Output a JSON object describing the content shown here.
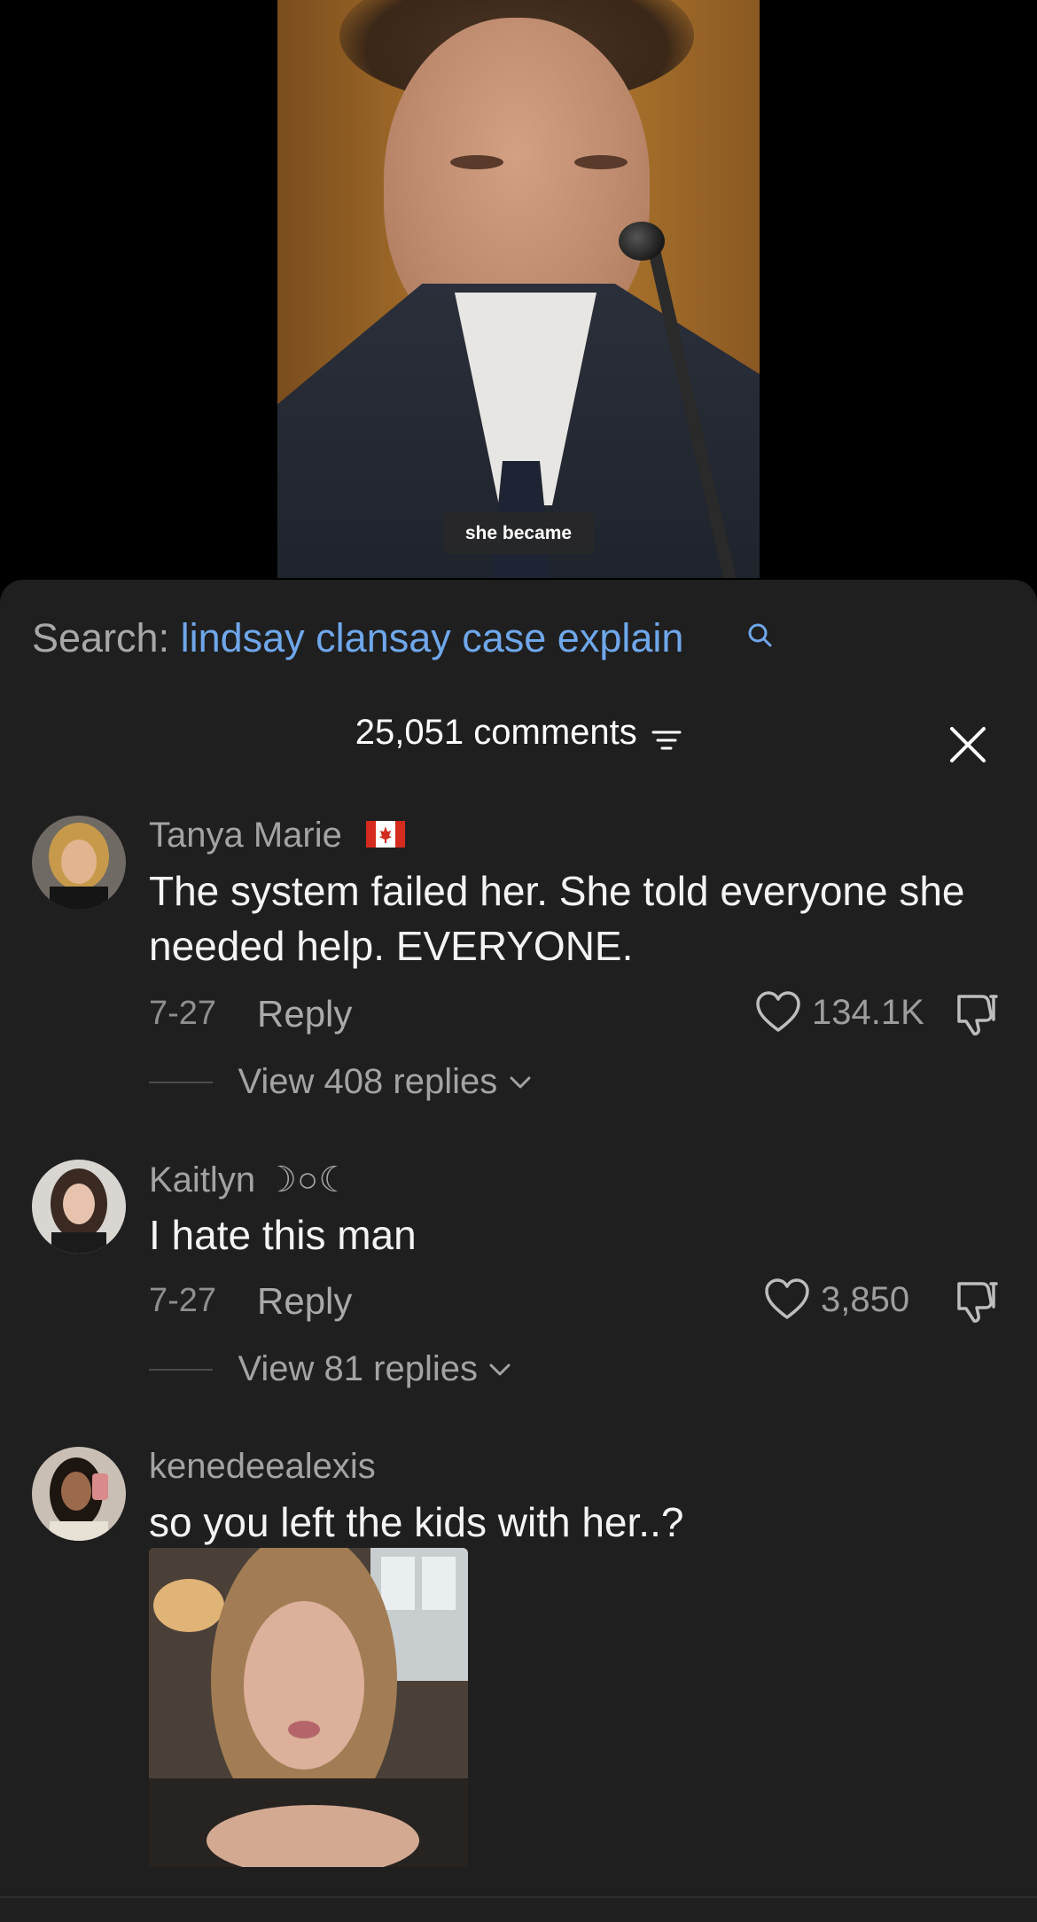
{
  "video": {
    "caption": "she became"
  },
  "search": {
    "prefix": "Search: ",
    "term": "lindsay clansay case explain"
  },
  "comments_header": {
    "count_label": "25,051 comments"
  },
  "comments": [
    {
      "username": "Tanya Marie",
      "text": "The system failed her. She told everyone she needed help. EVERYONE.",
      "date": "7-27",
      "reply_label": "Reply",
      "likes": "134.1K",
      "view_replies": "View 408 replies"
    },
    {
      "username": "Kaitlyn ☽○☾",
      "text": "I hate this man",
      "date": "7-27",
      "reply_label": "Reply",
      "likes": "3,850",
      "view_replies": "View 81 replies"
    },
    {
      "username": "kenedeealexis",
      "text": "so you left the kids with her..?"
    }
  ],
  "colors": {
    "background": "#1f1f20",
    "accent_search": "#6fa7ea",
    "text": "#f4f4f4",
    "muted": "#a3a3a3"
  },
  "icons": [
    "search-icon",
    "filter-icon",
    "close-icon",
    "heart-icon",
    "dislike-icon",
    "chevron-down-icon",
    "canada-flag-icon"
  ]
}
